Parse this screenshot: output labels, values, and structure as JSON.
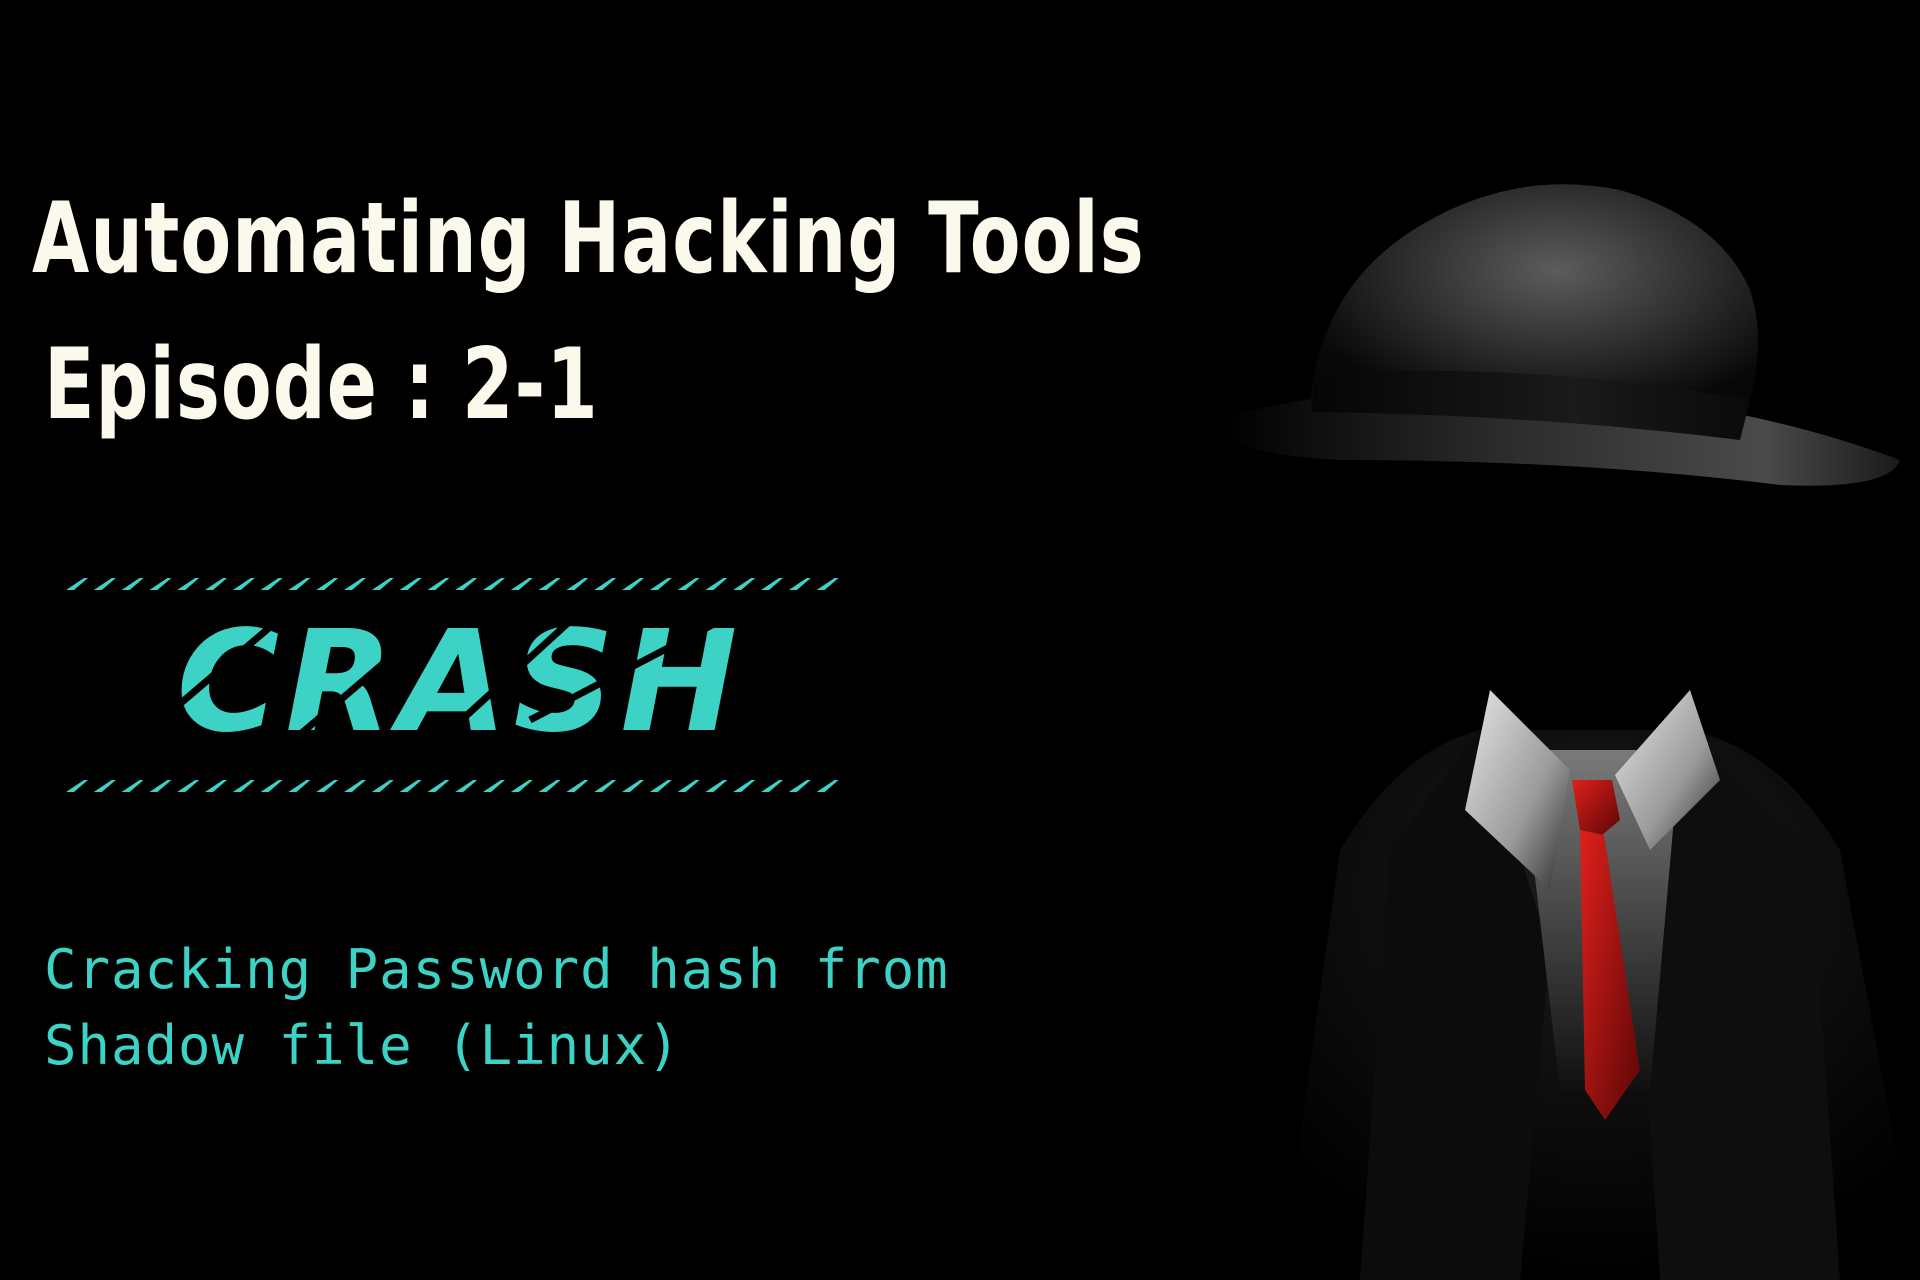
{
  "title": {
    "line1": "Automating Hacking Tools",
    "line2": "Episode : 2-1"
  },
  "logo": {
    "text": "CRASH",
    "color": "#3cd2c6"
  },
  "subtitle": {
    "line1": "Cracking Password hash from",
    "line2": "Shadow file (Linux)"
  },
  "figure": {
    "tie_color": "#c0100f"
  }
}
